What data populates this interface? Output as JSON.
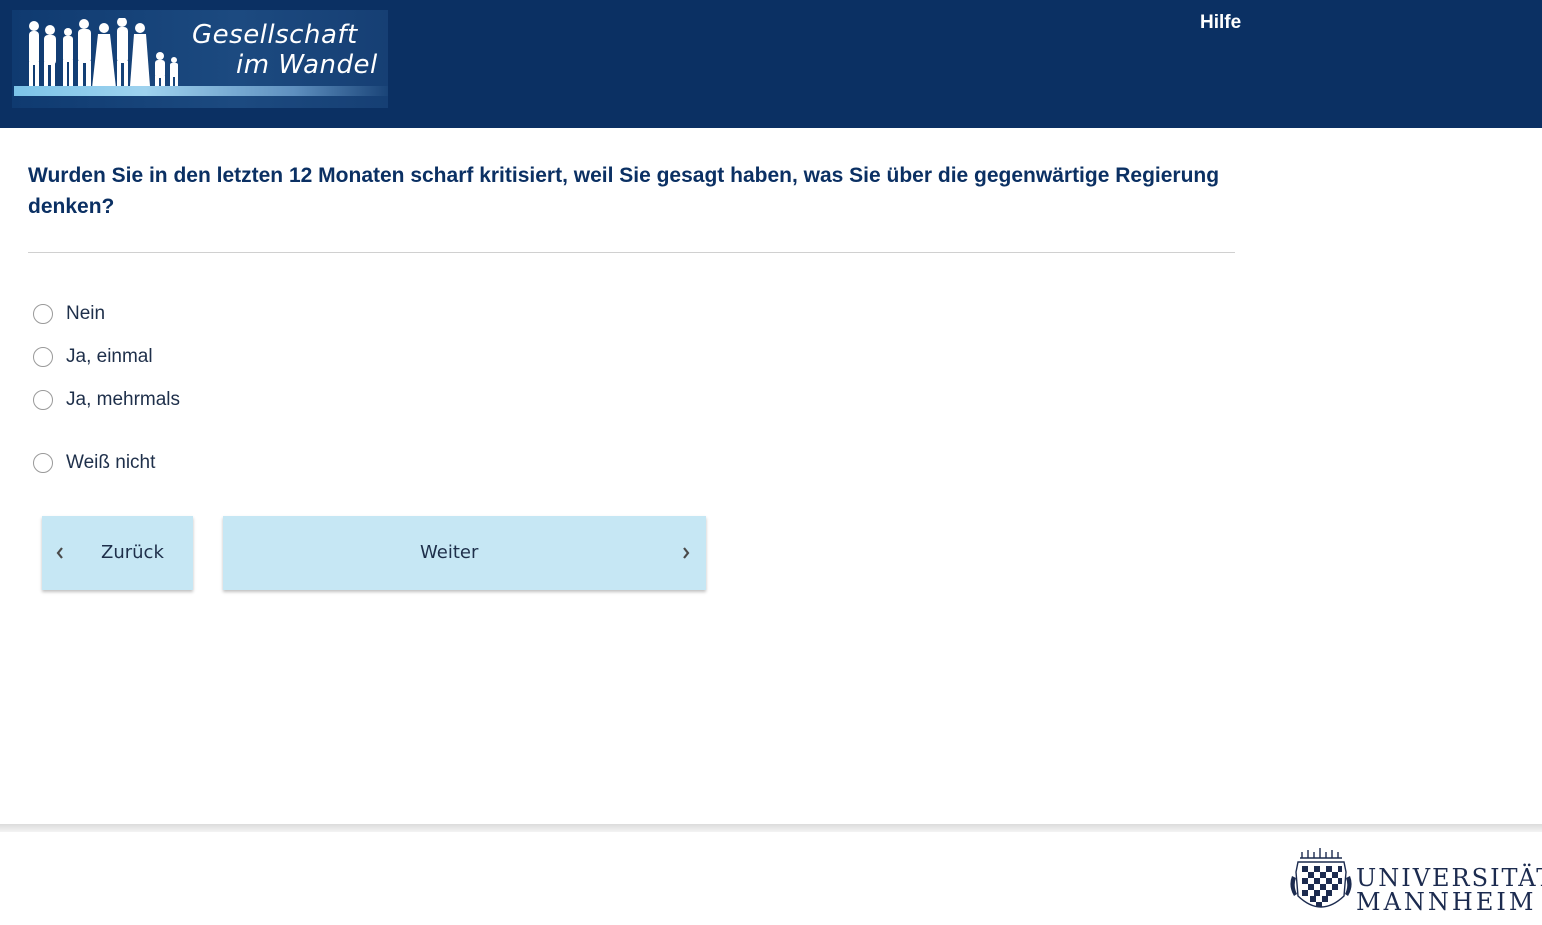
{
  "header": {
    "logo_line1": "Gesellschaft",
    "logo_line2": "im Wandel",
    "help_label": "Hilfe",
    "background_color": "#0b3063"
  },
  "question": {
    "text": "Wurden Sie in den letzten 12 Monaten scharf kritisiert, weil Sie gesagt haben, was Sie über die gegenwärtige Regierung denken?"
  },
  "options": [
    {
      "label": "Nein",
      "selected": false
    },
    {
      "label": "Ja, einmal",
      "selected": false
    },
    {
      "label": "Ja, mehrmals",
      "selected": false
    },
    {
      "label": "Weiß nicht",
      "selected": false
    }
  ],
  "nav": {
    "back_label": "Zurück",
    "next_label": "Weiter",
    "button_color": "#c6e7f4"
  },
  "footer": {
    "university_line1": "UNIVERSITÄT",
    "university_line2": "MANNHEIM"
  }
}
